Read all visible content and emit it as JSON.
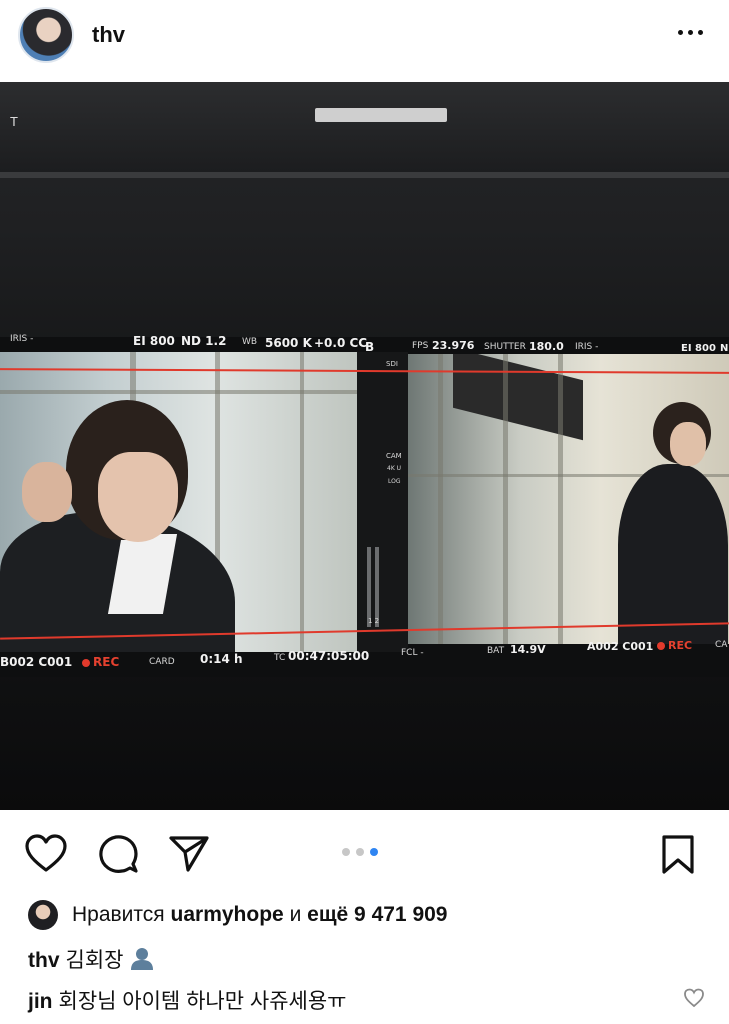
{
  "post": {
    "username": "thv",
    "more_icon": "more-horizontal-icon"
  },
  "photo_overlay": {
    "top_mark": "T",
    "left": {
      "iris": "IRIS -",
      "ei": "EI 800",
      "nd": "ND 1.2",
      "wb_label": "WB",
      "wb": "5600 K",
      "tint": "+0.0 CC",
      "channel": "B",
      "clip": "B002 C001",
      "rec": "REC",
      "card": "CARD",
      "remaining": "0:14 h",
      "tc_label": "TC",
      "tc": "00:47:05:00"
    },
    "center": {
      "sdi": "SDI",
      "cam": "CAM",
      "res": "4K U",
      "log": "LOG",
      "ch": "1 2"
    },
    "right": {
      "fps_label": "FPS",
      "fps": "23.976",
      "shutter_label": "SHUTTER",
      "shutter": "180.0",
      "iris": "IRIS -",
      "ei": "EI 800",
      "n": "N",
      "fcl": "FCL -",
      "bat_label": "BAT",
      "bat": "14.9V",
      "clip": "A002 C001",
      "rec": "REC",
      "ca": "CA"
    }
  },
  "actions": {
    "like_icon": "heart-icon",
    "comment_icon": "comment-icon",
    "share_icon": "send-icon",
    "save_icon": "bookmark-icon",
    "carousel_total": 3,
    "carousel_active": 3
  },
  "likes": {
    "prefix": "Нравится",
    "user": "uarmyhope",
    "middle": "и",
    "count_text": "ещё 9 471 909"
  },
  "caption": {
    "user": "thv",
    "text": "김회장",
    "emoji_icon": "bust-in-silhouette-icon"
  },
  "comment": {
    "user": "jin",
    "text": "회장님 아이템 하나만 사쥬세용ㅠ",
    "like_icon": "heart-outline-small-icon"
  }
}
